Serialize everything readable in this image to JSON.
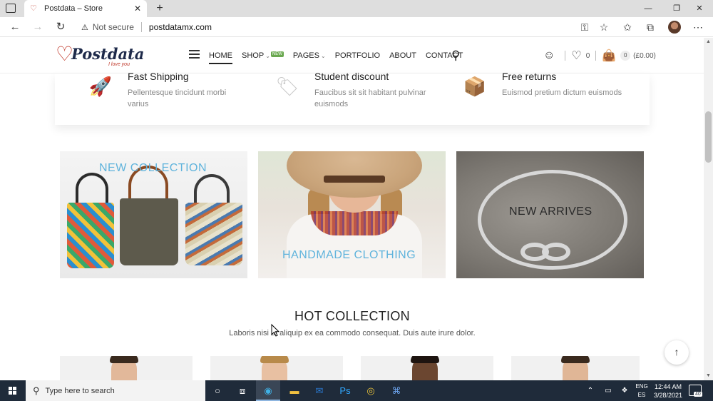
{
  "browser": {
    "tab_title": "Postdata – Store",
    "tab_close": "✕",
    "new_tab": "+",
    "security_label": "Not secure",
    "url": "postdatamx.com",
    "window_min": "—",
    "window_restore": "❐",
    "window_close": "✕"
  },
  "site": {
    "logo_text": "Postdata",
    "logo_tagline": "I love you",
    "nav": [
      {
        "label": "HOME"
      },
      {
        "label": "SHOP",
        "badge": "NEW"
      },
      {
        "label": "PAGES"
      },
      {
        "label": "PORTFOLIO"
      },
      {
        "label": "ABOUT"
      },
      {
        "label": "CONTACT"
      }
    ],
    "wishlist_count": "0",
    "cart_count": "0",
    "cart_total": "(£0.00)"
  },
  "features": [
    {
      "icon": "rocket-icon",
      "title": "Fast Shipping",
      "desc": "Pellentesque tincidunt morbi varius"
    },
    {
      "icon": "sale-tag-icon",
      "title": "Student discount",
      "desc": "Faucibus sit sit habitant pulvinar euismods"
    },
    {
      "icon": "returns-box-icon",
      "title": "Free returns",
      "desc": "Euismod pretium dictum euismods"
    }
  ],
  "banners": [
    {
      "label": "NEW COLLECTION",
      "color": "#5fb3dc"
    },
    {
      "label": "HANDMADE CLOTHING",
      "color": "#5fb3dc"
    },
    {
      "label": "NEW ARRIVES",
      "color": "#2a2a2a"
    }
  ],
  "hot": {
    "title": "HOT COLLECTION",
    "subtitle": "Laboris nisi ut aliquip ex ea commodo consequat. Duis aute irure dolor."
  },
  "taskbar": {
    "search_placeholder": "Type here to search",
    "lang_line1": "ENG",
    "lang_line2": "ES",
    "time": "12:44 AM",
    "date": "3/28/2021",
    "notification_count": "40"
  }
}
